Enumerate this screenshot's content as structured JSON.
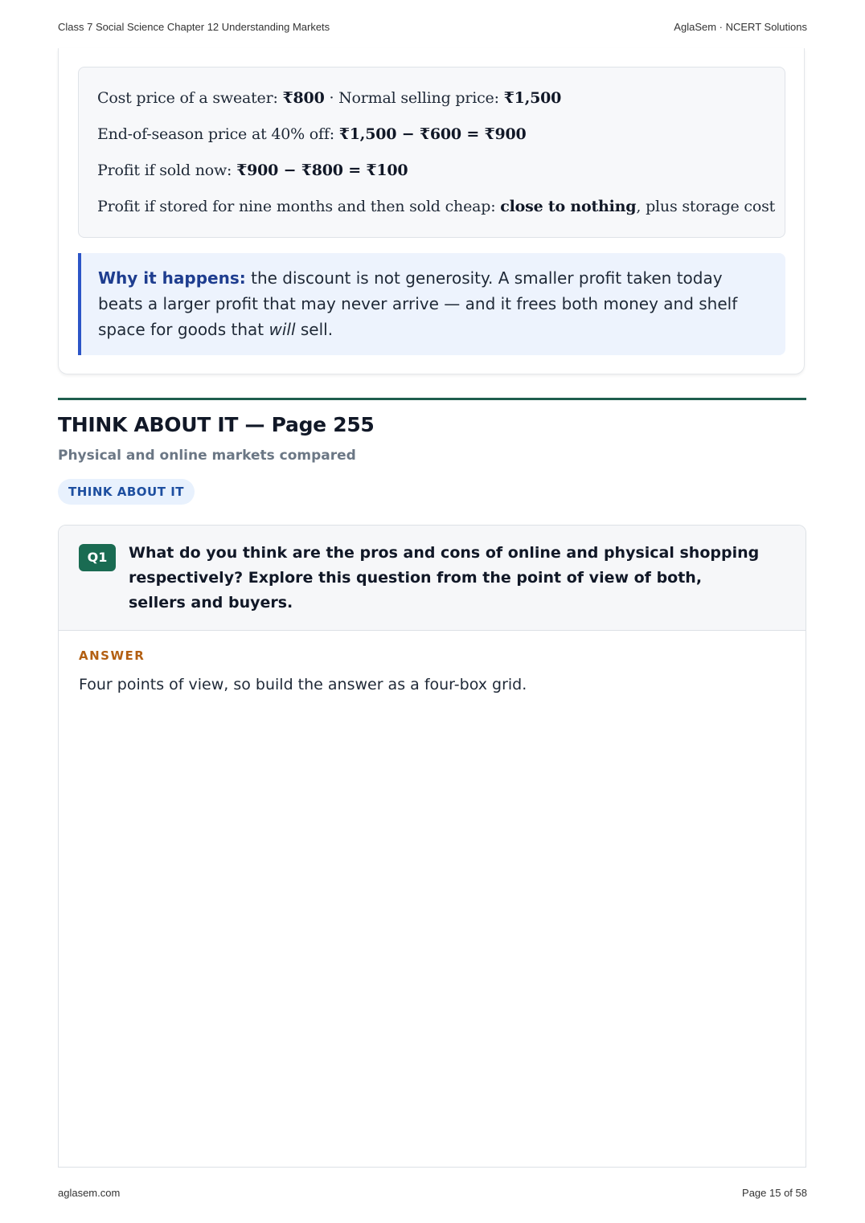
{
  "header": {
    "left": "Class 7 Social Science Chapter 12 Understanding Markets",
    "right": "AglaSem · NCERT Solutions"
  },
  "calculation": {
    "line1": {
      "pre": "Cost price of a sweater: ",
      "cost": "₹800",
      "mid": " · Normal selling price: ",
      "price": "₹1,500"
    },
    "line2": {
      "pre": "End-of-season price at 40% off: ",
      "expr": "₹1,500 − ₹600 = ₹900"
    },
    "line3": {
      "pre": "Profit if sold now: ",
      "expr": "₹900 − ₹800 = ₹100"
    },
    "line4": {
      "pre": "Profit if stored for nine months and then sold cheap: ",
      "bold": "close to nothing",
      "post": ", plus storage cost"
    }
  },
  "why_box": {
    "label": "Why it happens:",
    "text_before": " the discount is not generosity. A smaller profit taken today beats a larger profit that may never arrive — and it frees both money and shelf space for goods that ",
    "emphasis": "will",
    "text_after": " sell."
  },
  "section": {
    "title": "THINK ABOUT IT — Page 255",
    "subtitle": "Physical and online markets compared",
    "pill": "THINK ABOUT IT"
  },
  "question": {
    "badge": "Q1",
    "text": "What do you think are the pros and cons of online and physical shopping respectively? Explore this question from the point of view of both, sellers and buyers.",
    "answer_label": "ANSWER",
    "answer_text": "Four points of view, so build the answer as a four-box grid."
  },
  "footer": {
    "left": "aglasem.com",
    "right": "Page 15 of 58"
  }
}
